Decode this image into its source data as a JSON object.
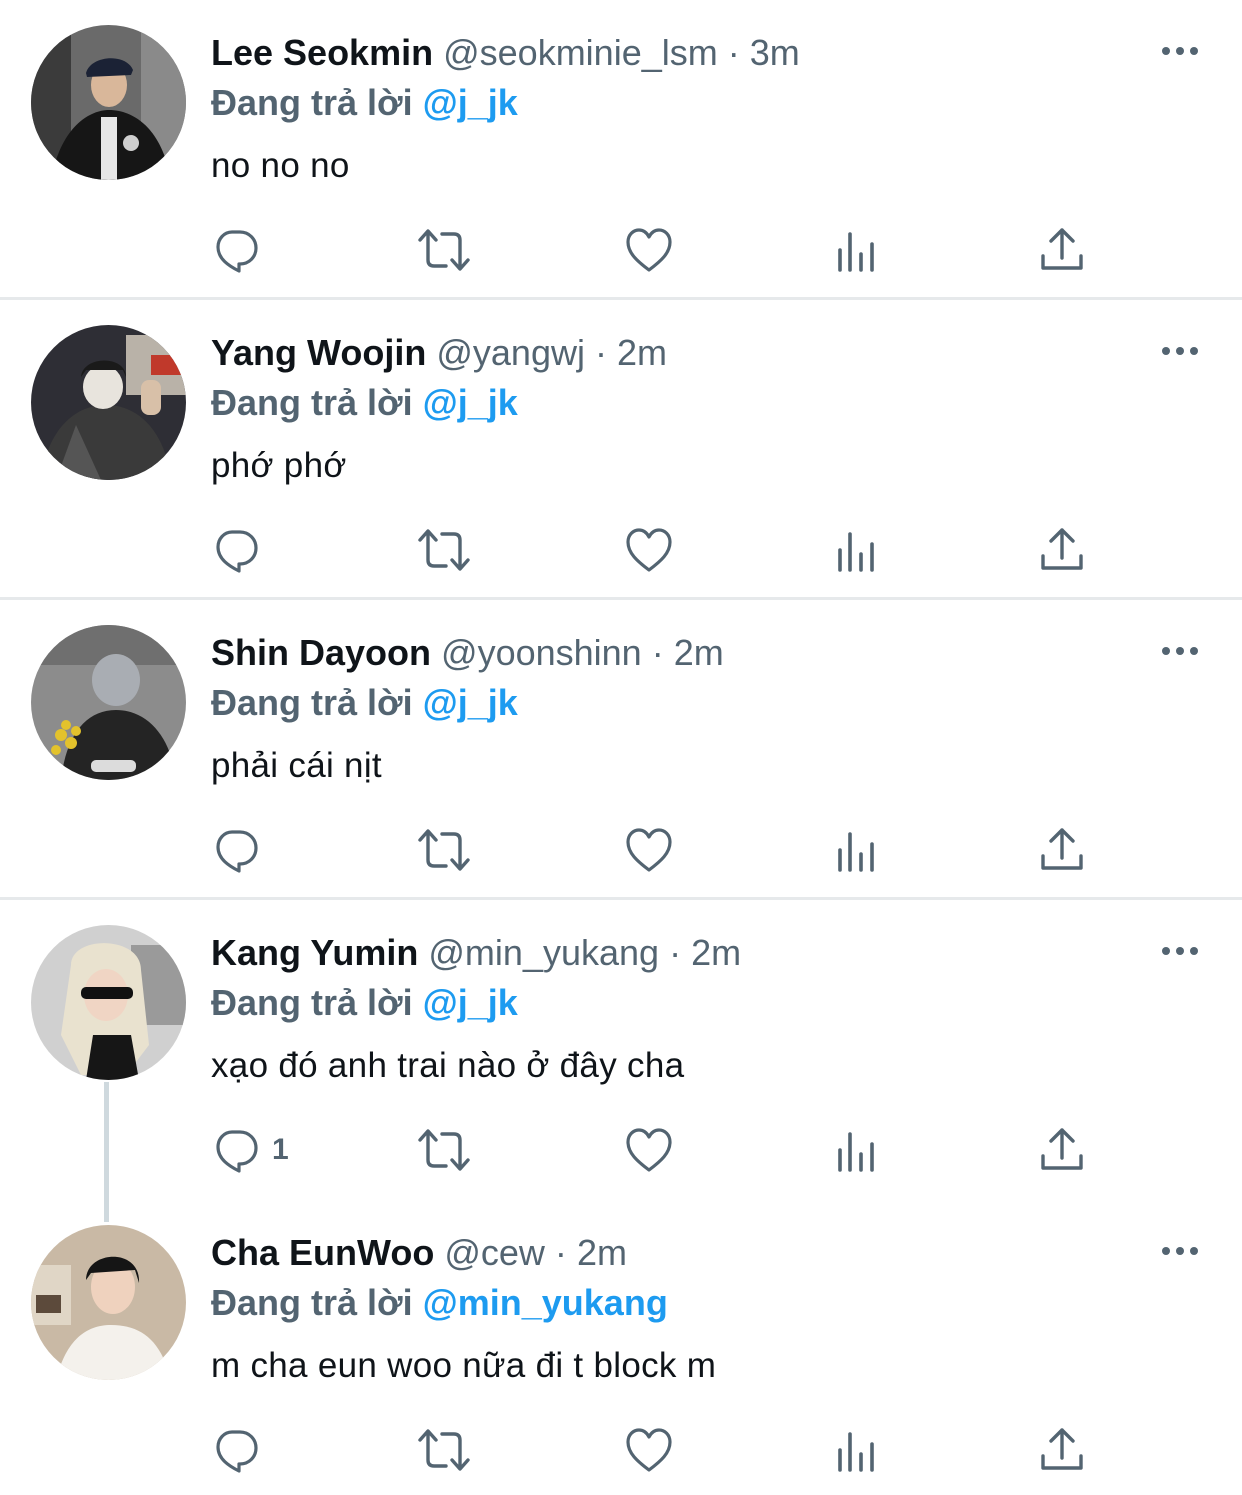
{
  "replying_prefix": "Đang trả lời",
  "tweets": [
    {
      "name": "Lee Seokmin",
      "handle": "@seokminie_lsm",
      "time": "3m",
      "reply_to": "@j_jk",
      "text": "no no no",
      "reply_count": ""
    },
    {
      "name": "Yang Woojin",
      "handle": "@yangwj",
      "time": "2m",
      "reply_to": "@j_jk",
      "text": "phớ phớ",
      "reply_count": ""
    },
    {
      "name": "Shin Dayoon",
      "handle": "@yoonshinn",
      "time": "2m",
      "reply_to": "@j_jk",
      "text": "phải cái nịt",
      "reply_count": ""
    },
    {
      "name": "Kang Yumin",
      "handle": "@min_yukang",
      "time": "2m",
      "reply_to": "@j_jk",
      "text": "xạo đó anh trai nào ở đây cha",
      "reply_count": "1"
    },
    {
      "name": "Cha EunWoo",
      "handle": "@cew",
      "time": "2m",
      "reply_to": "@min_yukang",
      "text": "m cha eun woo nữa đi t block m",
      "reply_count": ""
    }
  ],
  "separator": "·",
  "colors": {
    "text": "#0f1419",
    "secondary": "#536471",
    "accent": "#1d9bf0",
    "divider": "#e6e9eb",
    "thread_line": "#cfd9de"
  },
  "icons": [
    "reply-icon",
    "retweet-icon",
    "like-icon",
    "views-icon",
    "share-icon",
    "more-icon"
  ]
}
